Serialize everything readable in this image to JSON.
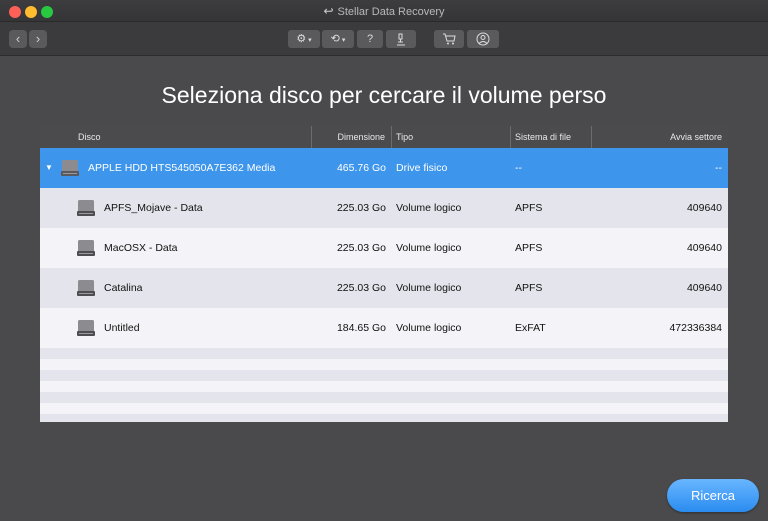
{
  "window": {
    "title": "Stellar Data Recovery"
  },
  "toolbar": {
    "back_icon": "chevron-left-icon",
    "forward_icon": "chevron-right-icon",
    "help_label": "?"
  },
  "main": {
    "heading": "Seleziona disco per cercare il volume perso"
  },
  "table": {
    "columns": [
      "Disco",
      "Dimensione",
      "Tipo",
      "Sistema di file",
      "Avvia settore"
    ],
    "rows": [
      {
        "name": "APPLE HDD HTS545050A7E362 Media",
        "size": "465.76 Go",
        "type": "Drive fisico",
        "fs": "--",
        "start": "--",
        "selected": true
      },
      {
        "name": "APFS_Mojave - Data",
        "size": "225.03 Go",
        "type": "Volume logico",
        "fs": "APFS",
        "start": "409640"
      },
      {
        "name": "MacOSX - Data",
        "size": "225.03 Go",
        "type": "Volume logico",
        "fs": "APFS",
        "start": "409640"
      },
      {
        "name": "Catalina",
        "size": "225.03 Go",
        "type": "Volume logico",
        "fs": "APFS",
        "start": "409640"
      },
      {
        "name": "Untitled",
        "size": "184.65 Go",
        "type": "Volume logico",
        "fs": "ExFAT",
        "start": "472336384"
      }
    ]
  },
  "actions": {
    "search_label": "Ricerca"
  },
  "colors": {
    "accent": "#3e95ec",
    "background": "#4a4a4c",
    "button": "#2a8cf0"
  }
}
